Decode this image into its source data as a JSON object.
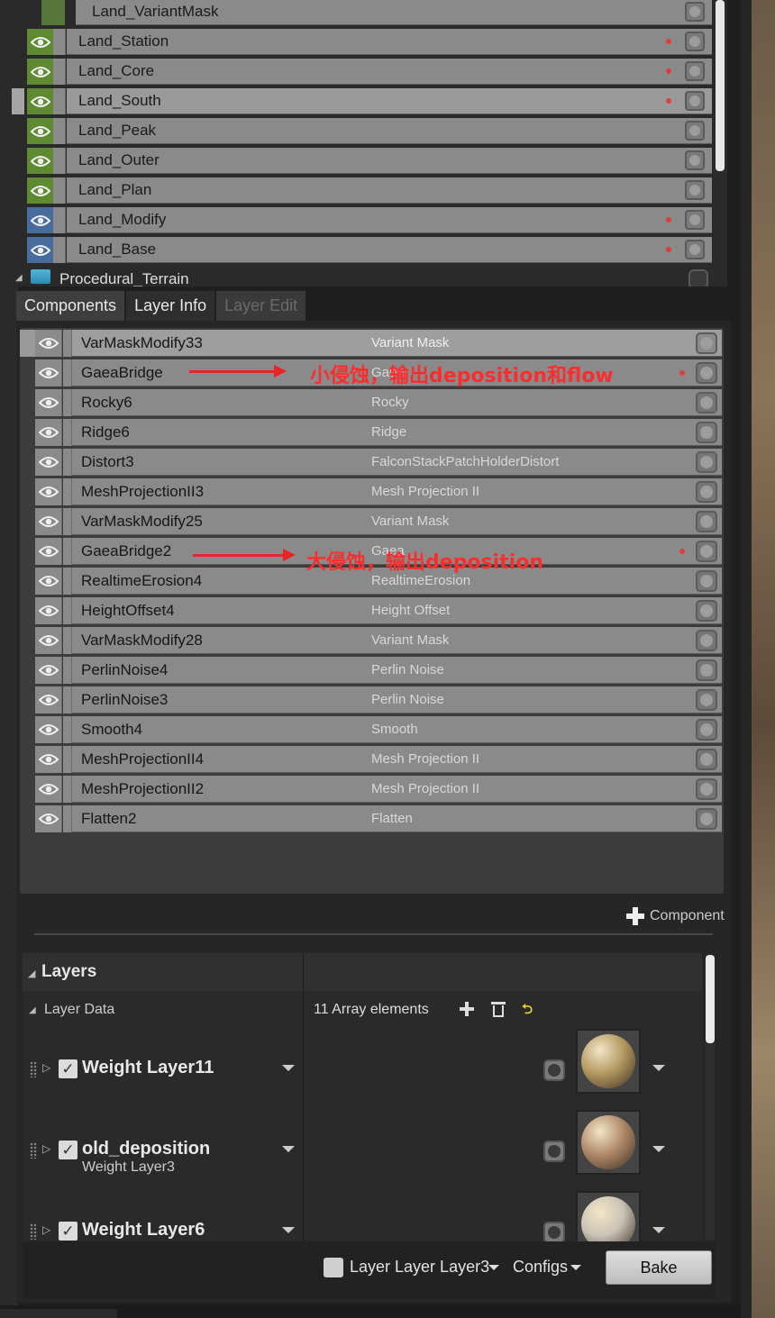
{
  "outliner": {
    "partial_item": "Land_VariantMask",
    "items": [
      {
        "label": "Land_Station",
        "eye": "green",
        "dot": true
      },
      {
        "label": "Land_Core",
        "eye": "green",
        "dot": true
      },
      {
        "label": "Land_South",
        "eye": "green",
        "dot": true,
        "selected": true
      },
      {
        "label": "Land_Peak",
        "eye": "green",
        "dot": false
      },
      {
        "label": "Land_Outer",
        "eye": "green",
        "dot": false
      },
      {
        "label": "Land_Plan",
        "eye": "green",
        "dot": false
      },
      {
        "label": "Land_Modify",
        "eye": "blue",
        "dot": true
      },
      {
        "label": "Land_Base",
        "eye": "blue",
        "dot": true
      }
    ],
    "group": "Procedural_Terrain"
  },
  "tabs": [
    {
      "label": "Components",
      "state": "active"
    },
    {
      "label": "Layer Info",
      "state": "normal"
    },
    {
      "label": "Layer Edit",
      "state": "disabled"
    }
  ],
  "components": [
    {
      "name": "VarMaskModify33",
      "type": "Variant Mask",
      "dot": false
    },
    {
      "name": "GaeaBridge",
      "type": "Gaea",
      "dot": true
    },
    {
      "name": "Rocky6",
      "type": "Rocky",
      "dot": false
    },
    {
      "name": "Ridge6",
      "type": "Ridge",
      "dot": false
    },
    {
      "name": "Distort3",
      "type": "FalconStackPatchHolderDistort",
      "dot": false
    },
    {
      "name": "MeshProjectionII3",
      "type": "Mesh Projection II",
      "dot": false
    },
    {
      "name": "VarMaskModify25",
      "type": "Variant Mask",
      "dot": false
    },
    {
      "name": "GaeaBridge2",
      "type": "Gaea",
      "dot": true
    },
    {
      "name": "RealtimeErosion4",
      "type": "RealtimeErosion",
      "dot": false
    },
    {
      "name": "HeightOffset4",
      "type": "Height Offset",
      "dot": false
    },
    {
      "name": "VarMaskModify28",
      "type": "Variant Mask",
      "dot": false
    },
    {
      "name": "PerlinNoise4",
      "type": "Perlin Noise",
      "dot": false
    },
    {
      "name": "PerlinNoise3",
      "type": "Perlin Noise",
      "dot": false
    },
    {
      "name": "Smooth4",
      "type": "Smooth",
      "dot": false
    },
    {
      "name": "MeshProjectionII4",
      "type": "Mesh Projection II",
      "dot": false
    },
    {
      "name": "MeshProjectionII2",
      "type": "Mesh Projection II",
      "dot": false
    },
    {
      "name": "Flatten2",
      "type": "Flatten",
      "dot": false
    }
  ],
  "annotations": {
    "note1": "小侵蚀，输出deposition和flow",
    "note2": "大侵蚀，输出deposition"
  },
  "add_component_label": "Component",
  "layers": {
    "title": "Layers",
    "data_label": "Layer Data",
    "array_count": "11 Array elements",
    "items": [
      {
        "name": "Weight Layer11",
        "sub": "",
        "ball": "#b59a62"
      },
      {
        "name": "old_deposition",
        "sub": "Weight Layer3",
        "ball": "#b08a6a"
      },
      {
        "name": "Weight Layer6",
        "sub": "",
        "ball": "#c9c3b5"
      }
    ]
  },
  "bottom": {
    "layer_label": "Layer Layer Layer3",
    "configs_label": "Configs",
    "bake_label": "Bake"
  },
  "colors": {
    "eye_green": "#5e8a32",
    "eye_blue": "#486c9c",
    "annotation_red": "#ff2d2d"
  }
}
